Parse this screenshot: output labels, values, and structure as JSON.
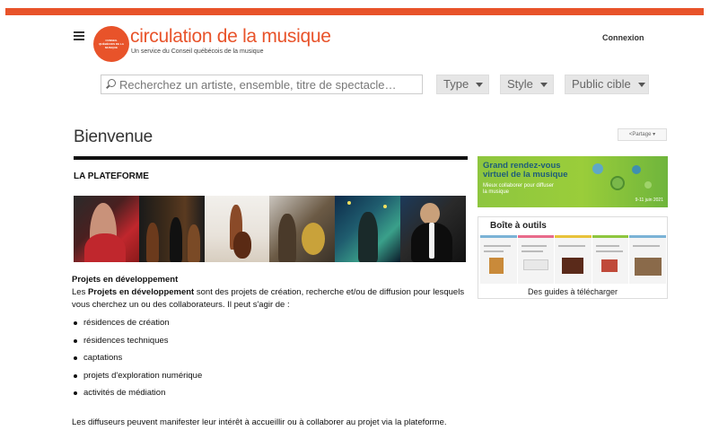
{
  "header": {
    "logo_text": "CONSEIL QUÉBÉCOIS DE LA MUSIQUE",
    "site_title": "circulation de la musique",
    "site_subtitle": "Un service du Conseil québécois de la musique",
    "login_label": "Connexion",
    "menu_icon": "hamburger-icon"
  },
  "search": {
    "placeholder": "Recherchez un artiste, ensemble, titre de spectacle…",
    "icon": "search-icon"
  },
  "filters": {
    "type_label": "Type",
    "style_label": "Style",
    "audience_label": "Public cible"
  },
  "page": {
    "title": "Bienvenue",
    "share_label": "<Partage ▾"
  },
  "main": {
    "section_title": "LA PLATEFORME",
    "projects_heading": "Projets en développement",
    "intro_bold": "Projets en développement",
    "intro_pre": "Les ",
    "intro_post": " sont des projets de création, recherche et/ou de diffusion pour lesquels vous cherchez un ou des collaborateurs. Il peut s'agir de :",
    "list": [
      "résidences de création",
      "résidences techniques",
      "captations",
      "projets d'exploration numérique",
      "activités de médiation"
    ],
    "closing": "Les diffuseurs peuvent manifester leur intérêt à accueillir ou à collaborer au projet via la plateforme."
  },
  "sidebar": {
    "banner_title": "Grand rendez-vous virtuel de la musique",
    "banner_sub": "Mieux collaborer pour diffuser la musique",
    "banner_date": "9-11 juin 2021",
    "toolbox_title": "Boîte à outils",
    "toolbox_caption": "Des guides à télécharger"
  },
  "colors": {
    "accent": "#e8532a",
    "banner_green": "#8ec63f"
  }
}
